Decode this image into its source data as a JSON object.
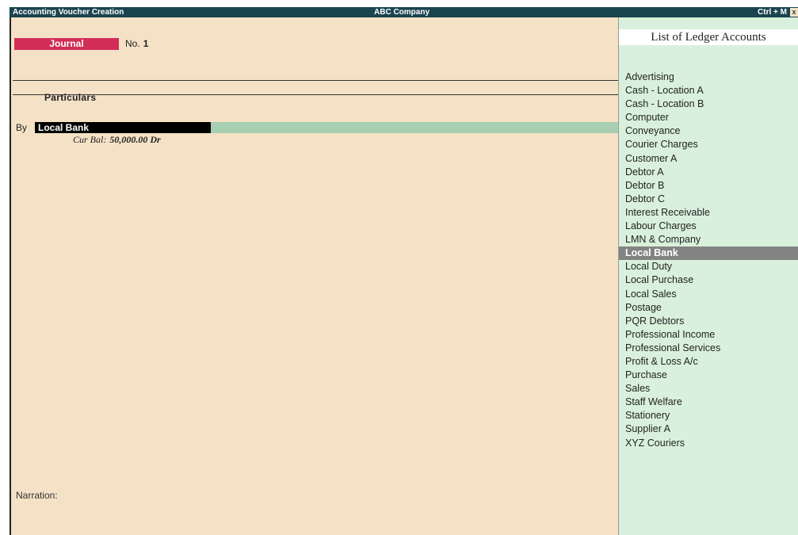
{
  "titlebar": {
    "left": "Accounting Voucher  Creation",
    "center": "ABC Company",
    "right": "Ctrl + M",
    "close_glyph": "x"
  },
  "voucher": {
    "type": "Journal",
    "no_label": "No.",
    "no_value": "1",
    "particulars_header": "Particulars",
    "by_label": "By",
    "ledger_value": "Local Bank",
    "amount_value": "",
    "cur_bal_label": "Cur Bal:",
    "cur_bal_value": "50,000.00 Dr",
    "narration_label": "Narration:"
  },
  "ledger_list": {
    "title": "List of Ledger Accounts",
    "selected": "Local Bank",
    "items": [
      "Advertising",
      "Cash - Location A",
      "Cash - Location B",
      "Computer",
      "Conveyance",
      "Courier Charges",
      "Customer A",
      "Debtor A",
      "Debtor B",
      "Debtor C",
      "Interest Receivable",
      "Labour Charges",
      "LMN & Company",
      "Local Bank",
      "Local Duty",
      "Local Purchase",
      "Local Sales",
      "Postage",
      "PQR Debtors",
      "Professional Income",
      "Professional Services",
      "Profit & Loss A/c",
      "Purchase",
      "Sales",
      "Staff Welfare",
      "Stationery",
      "Supplier A",
      "XYZ Couriers"
    ]
  },
  "colors": {
    "titlebar_bg": "#1a4450",
    "form_bg": "#f5e2c6",
    "voucher_type_bg": "#d12e57",
    "amount_field_bg": "#a8cfb2",
    "list_bg": "#d9f1dc",
    "selected_bg": "#838383"
  }
}
